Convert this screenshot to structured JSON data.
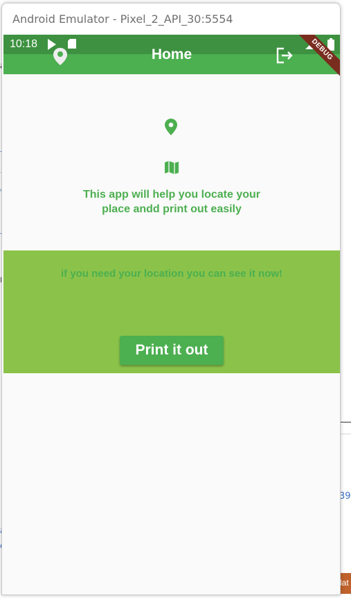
{
  "window": {
    "title": "Android Emulator - Pixel_2_API_30:5554"
  },
  "status_bar": {
    "time": "10:18"
  },
  "app_bar": {
    "title": "Home",
    "debug_banner": "DEBUG"
  },
  "intro_text": [
    "This app will help you locate your",
    "place andd print out easily"
  ],
  "band": {
    "text": "if you need your location you can see it now!",
    "button_label": "Print it out"
  },
  "colors": {
    "primary": "#4caf50",
    "status_bar": "#3d9140",
    "band": "#8bc34a"
  },
  "background_fragments": [
    "a",
    "子",
    "。",
    "n",
    "子",
    "39",
    "a",
    "o",
    "lat"
  ]
}
